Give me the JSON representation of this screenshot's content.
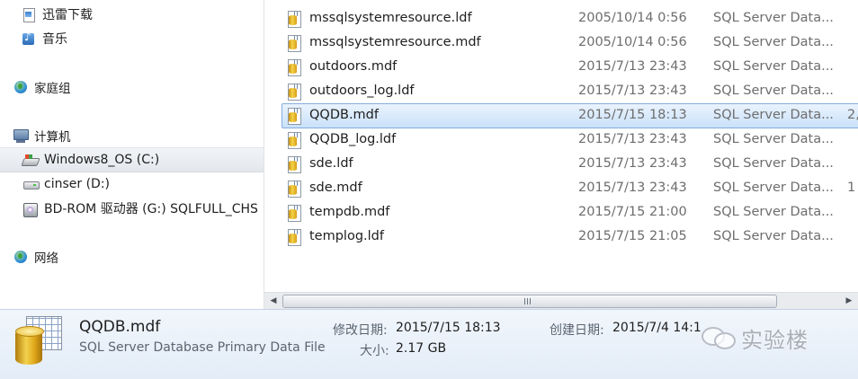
{
  "nav": {
    "items": [
      {
        "label": "迅雷下载",
        "icon": "download-folder-icon"
      },
      {
        "label": "音乐",
        "icon": "music-folder-icon"
      },
      {
        "label": "家庭组",
        "icon": "homegroup-icon"
      },
      {
        "label": "计算机",
        "icon": "computer-icon"
      },
      {
        "label": "Windows8_OS (C:)",
        "icon": "os-drive-icon",
        "selected": true
      },
      {
        "label": "cinser (D:)",
        "icon": "drive-icon"
      },
      {
        "label": "BD-ROM 驱动器 (G:) SQLFULL_CHS",
        "icon": "cd-drive-icon"
      },
      {
        "label": "网络",
        "icon": "network-icon"
      }
    ]
  },
  "files": [
    {
      "name": "mssqlsystemresource.ldf",
      "date": "2005/10/14 0:56",
      "type": "SQL Server Data...",
      "size": ""
    },
    {
      "name": "mssqlsystemresource.mdf",
      "date": "2005/10/14 0:56",
      "type": "SQL Server Data...",
      "size": ""
    },
    {
      "name": "outdoors.mdf",
      "date": "2015/7/13 23:43",
      "type": "SQL Server Data...",
      "size": ""
    },
    {
      "name": "outdoors_log.ldf",
      "date": "2015/7/13 23:43",
      "type": "SQL Server Data...",
      "size": ""
    },
    {
      "name": "QQDB.mdf",
      "date": "2015/7/15 18:13",
      "type": "SQL Server Data...",
      "size": "2,",
      "selected": true
    },
    {
      "name": "QQDB_log.ldf",
      "date": "2015/7/13 23:43",
      "type": "SQL Server Data...",
      "size": ""
    },
    {
      "name": "sde.ldf",
      "date": "2015/7/13 23:43",
      "type": "SQL Server Data...",
      "size": ""
    },
    {
      "name": "sde.mdf",
      "date": "2015/7/13 23:43",
      "type": "SQL Server Data...",
      "size": "1"
    },
    {
      "name": "tempdb.mdf",
      "date": "2015/7/15 21:00",
      "type": "SQL Server Data...",
      "size": ""
    },
    {
      "name": "templog.ldf",
      "date": "2015/7/15 21:05",
      "type": "SQL Server Data...",
      "size": ""
    }
  ],
  "scrollbar": {
    "left_arrow": "◀",
    "right_arrow": "▶"
  },
  "details": {
    "name": "QQDB.mdf",
    "type": "SQL Server Database Primary Data File",
    "modified_label": "修改日期:",
    "modified_value": "2015/7/15 18:13",
    "created_label": "创建日期:",
    "created_value": "2015/7/4 14:1",
    "size_label": "大小:",
    "size_value": "2.17 GB"
  },
  "watermark": {
    "text": "实验楼"
  },
  "colors": {
    "selection_bg": "#c9e1fa",
    "selection_border": "#84acdd",
    "details_bg": "#e3ecf7"
  }
}
